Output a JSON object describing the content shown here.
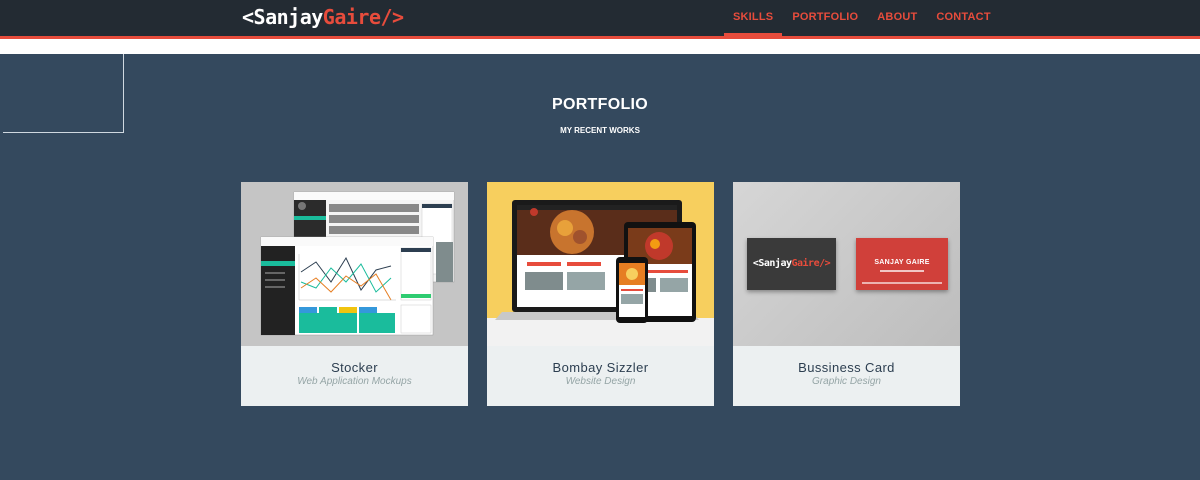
{
  "navbar": {
    "logo_left": "<Sanjay",
    "logo_right": "Gaire/>",
    "links": [
      {
        "label": "SKILLS",
        "active": true
      },
      {
        "label": "PORTFOLIO",
        "active": false
      },
      {
        "label": "ABOUT",
        "active": false
      },
      {
        "label": "CONTACT",
        "active": false
      }
    ]
  },
  "portfolio": {
    "title": "PORTFOLIO",
    "subtitle": "MY RECENT WORKS",
    "items": [
      {
        "title": "Stocker",
        "category": "Web Application Mockups",
        "thumb": "dashboard-mockup"
      },
      {
        "title": "Bombay Sizzler",
        "category": "Website Design",
        "thumb": "responsive-devices-mockup"
      },
      {
        "title": "Bussiness Card",
        "category": "Graphic Design",
        "thumb": "business-card-mockup"
      }
    ],
    "card2_name": "SANJAY GAIRE"
  },
  "colors": {
    "accent": "#e74c3c",
    "navbar_bg": "#232b33",
    "page_bg": "#34495e",
    "card_bg": "#ecf0f1",
    "teal": "#1abc9c"
  }
}
